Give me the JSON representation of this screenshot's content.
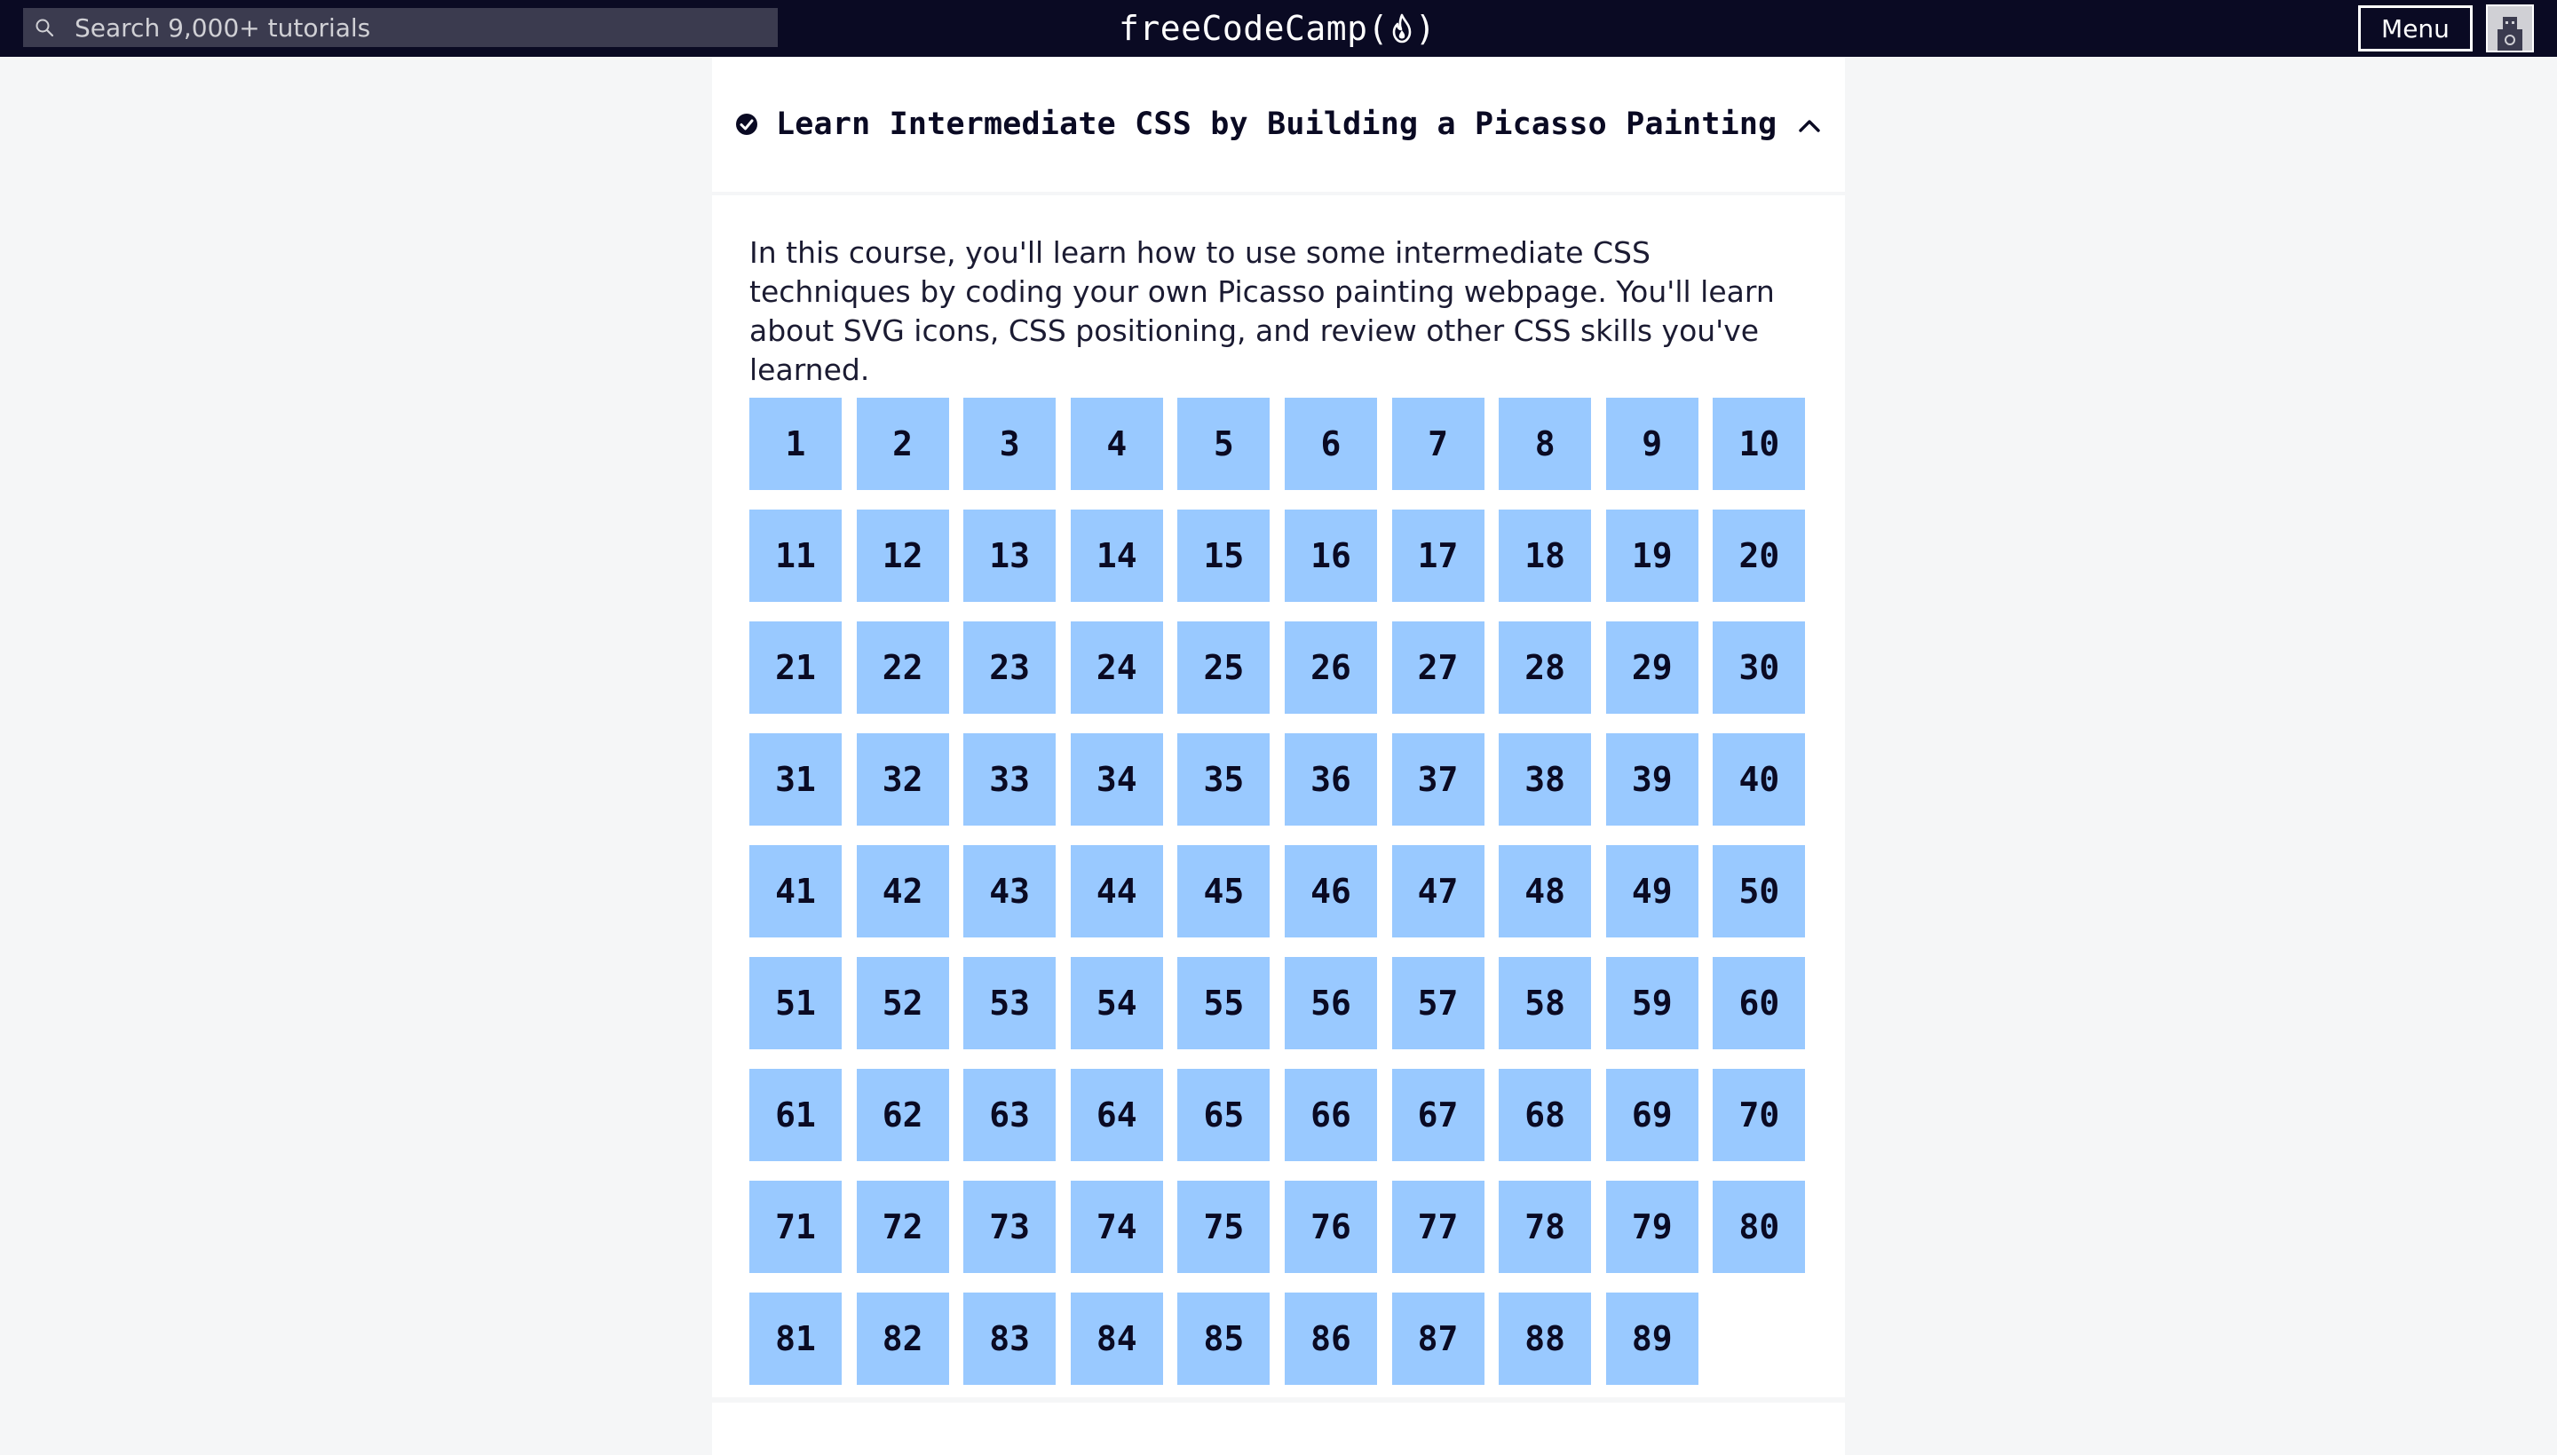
{
  "navbar": {
    "search": {
      "placeholder": "Search 9,000+ tutorials",
      "icon": "search-icon"
    },
    "logo_text_left": "freeCodeCamp(",
    "logo_text_right": ")",
    "menu_label": "Menu",
    "colors": {
      "background": "#0a0a23",
      "search_bg": "#3b3b4f"
    }
  },
  "block": {
    "title": "Learn Intermediate CSS by Building a Picasso Painting",
    "completed": true,
    "expanded": true,
    "description": "In this course, you'll learn how to use some intermediate CSS techniques by coding your own Picasso painting webpage. You'll learn about SVG icons, CSS positioning, and review other CSS skills you've learned.",
    "steps": [
      "1",
      "2",
      "3",
      "4",
      "5",
      "6",
      "7",
      "8",
      "9",
      "10",
      "11",
      "12",
      "13",
      "14",
      "15",
      "16",
      "17",
      "18",
      "19",
      "20",
      "21",
      "22",
      "23",
      "24",
      "25",
      "26",
      "27",
      "28",
      "29",
      "30",
      "31",
      "32",
      "33",
      "34",
      "35",
      "36",
      "37",
      "38",
      "39",
      "40",
      "41",
      "42",
      "43",
      "44",
      "45",
      "46",
      "47",
      "48",
      "49",
      "50",
      "51",
      "52",
      "53",
      "54",
      "55",
      "56",
      "57",
      "58",
      "59",
      "60",
      "61",
      "62",
      "63",
      "64",
      "65",
      "66",
      "67",
      "68",
      "69",
      "70",
      "71",
      "72",
      "73",
      "74",
      "75",
      "76",
      "77",
      "78",
      "79",
      "80",
      "81",
      "82",
      "83",
      "84",
      "85",
      "86",
      "87",
      "88",
      "89"
    ],
    "colors": {
      "step_bg": "#99c9ff",
      "step_text": "#0a0a23"
    }
  }
}
